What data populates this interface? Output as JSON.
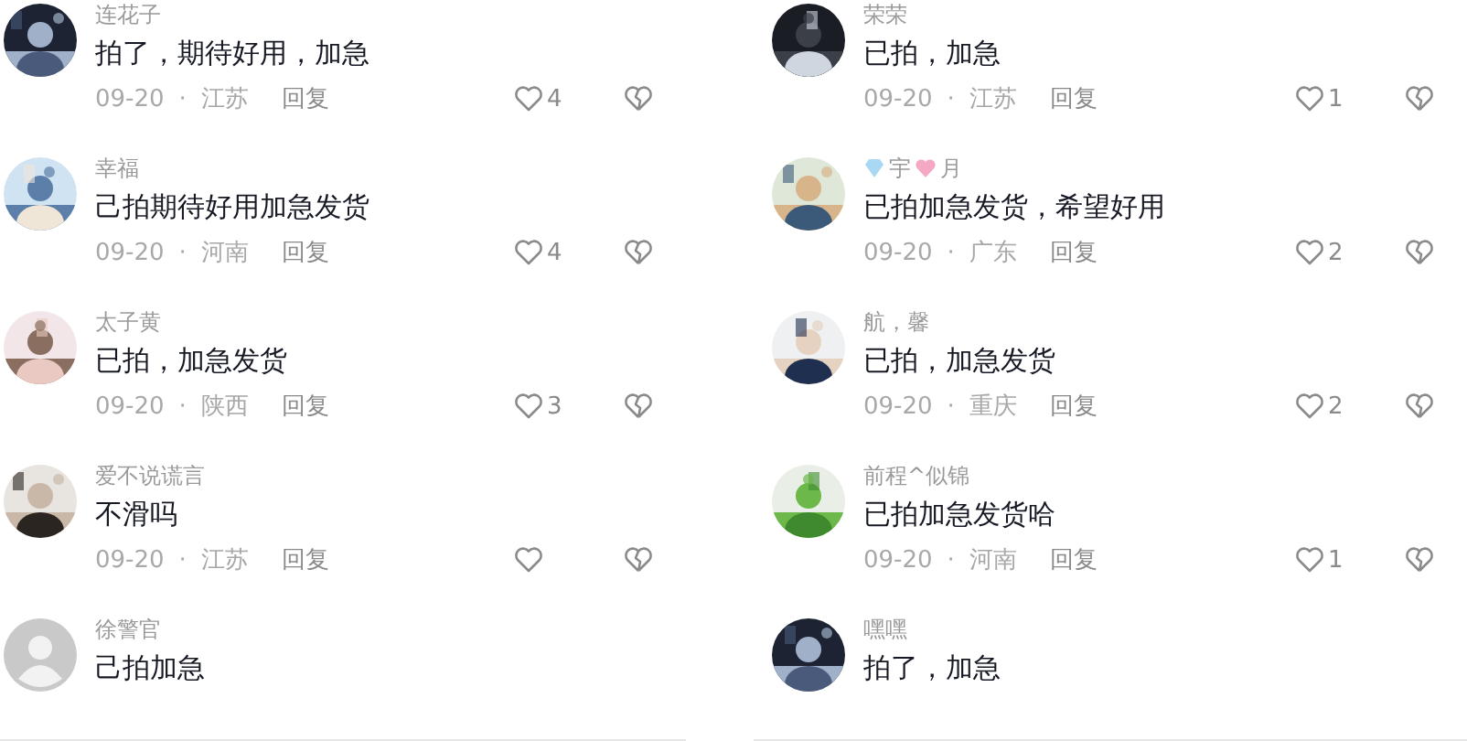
{
  "panels": [
    {
      "comments": [
        {
          "kind": "picture",
          "name": "连花子",
          "text": "拍了，期待好用，加急",
          "date": "09-20",
          "separator": "·",
          "region": "江苏",
          "reply": "回复",
          "likes": "4"
        },
        {
          "kind": "picture",
          "name": "幸福",
          "text": "己拍期待好用加急发货",
          "date": "09-20",
          "separator": "·",
          "region": "河南",
          "reply": "回复",
          "likes": "4"
        },
        {
          "kind": "picture",
          "name": "太子黄",
          "text": "已拍，加急发货",
          "date": "09-20",
          "separator": "·",
          "region": "陕西",
          "reply": "回复",
          "likes": "3"
        },
        {
          "kind": "picture",
          "name": "爱不说谎言",
          "text": "不滑吗",
          "date": "09-20",
          "separator": "·",
          "region": "江苏",
          "reply": "回复"
        },
        {
          "kind": "default",
          "name": "徐警官",
          "text": "己拍加急"
        }
      ]
    },
    {
      "comments": [
        {
          "kind": "picture",
          "name": "荣荣",
          "text": "已拍，加急",
          "date": "09-20",
          "separator": "·",
          "region": "江苏",
          "reply": "回复",
          "likes": "1"
        },
        {
          "kind": "picture",
          "name": "宇",
          "name_suffix": "月",
          "decorated": true,
          "text": "已拍加急发货，希望好用",
          "date": "09-20",
          "separator": "·",
          "region": "广东",
          "reply": "回复",
          "likes": "2"
        },
        {
          "kind": "picture",
          "name": "航，馨",
          "text": "已拍，加急发货",
          "date": "09-20",
          "separator": "·",
          "region": "重庆",
          "reply": "回复",
          "likes": "2"
        },
        {
          "kind": "picture",
          "name": "前程^似锦",
          "text": "已拍加急发货哈",
          "date": "09-20",
          "separator": "·",
          "region": "河南",
          "reply": "回复",
          "likes": "1"
        },
        {
          "kind": "picture",
          "name": "嘿嘿",
          "text": "拍了，加急"
        }
      ]
    }
  ]
}
